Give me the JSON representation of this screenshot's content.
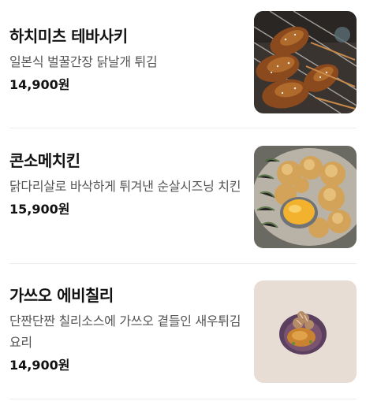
{
  "currency_suffix": "원",
  "items": [
    {
      "name": "하치미츠 테바사키",
      "description": "일본식 벌꿀간장 닭날개 튀김",
      "price": "14,900원",
      "photo_icon": "fried-chicken-wings-photo"
    },
    {
      "name": "콘소메치킨",
      "description": "닭다리살로 바삭하게 튀겨낸 순살시즈닝 치킨",
      "price": "15,900원",
      "photo_icon": "consomme-chicken-photo"
    },
    {
      "name": "가쓰오 에비칠리",
      "description": "단짠단짠 칠리소스에 가쓰오 곁들인 새우튀김요리",
      "price": "14,900원",
      "photo_icon": "katsuo-ebi-chili-photo"
    }
  ]
}
